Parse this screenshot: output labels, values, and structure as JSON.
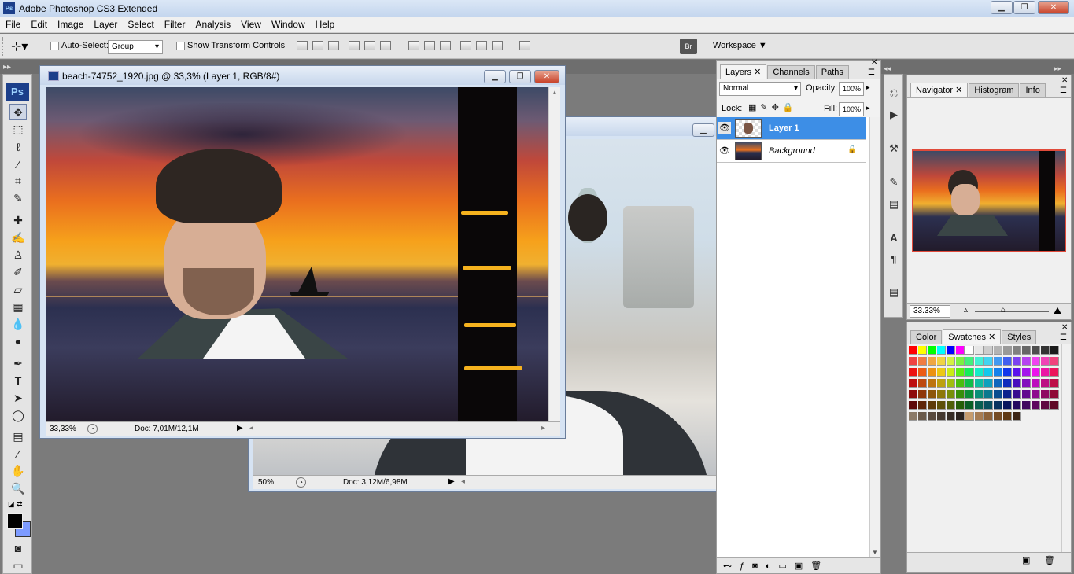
{
  "app": {
    "title": "Adobe Photoshop CS3 Extended",
    "logo": "Ps"
  },
  "menu": [
    "File",
    "Edit",
    "Image",
    "Layer",
    "Select",
    "Filter",
    "Analysis",
    "View",
    "Window",
    "Help"
  ],
  "options": {
    "auto_select_label": "Auto-Select:",
    "auto_select_value": "Group",
    "show_transform_label": "Show Transform Controls",
    "workspace_label": "Workspace ▼"
  },
  "doc1": {
    "title": "beach-74752_1920.jpg @ 33,3% (Layer 1, RGB/8#)",
    "zoom": "33,33%",
    "doc_size": "Doc: 7,01M/12,1M"
  },
  "doc2": {
    "zoom": "50%",
    "doc_size": "Doc: 3,12M/6,98M"
  },
  "layers_panel": {
    "tabs": [
      "Layers",
      "Channels",
      "Paths"
    ],
    "blend_mode": "Normal",
    "opacity_label": "Opacity:",
    "opacity_value": "100%",
    "lock_label": "Lock:",
    "fill_label": "Fill:",
    "fill_value": "100%",
    "layers": [
      {
        "name": "Layer 1",
        "selected": true
      },
      {
        "name": "Background",
        "selected": false,
        "locked": true
      }
    ]
  },
  "navigator_panel": {
    "tabs": [
      "Navigator",
      "Histogram",
      "Info"
    ],
    "zoom": "33.33%"
  },
  "swatches_panel": {
    "tabs": [
      "Color",
      "Swatches",
      "Styles"
    ]
  },
  "colors": {
    "selection_blue": "#3d8ee6",
    "photoshop_badge": "#1c3f8a",
    "foreground": "#000000",
    "background": "#7d9bff"
  }
}
